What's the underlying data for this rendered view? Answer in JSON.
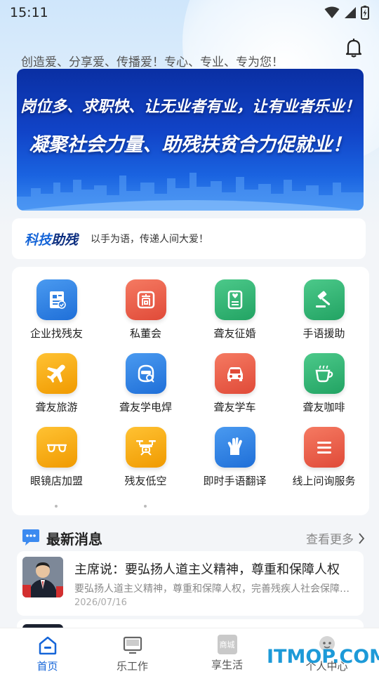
{
  "status_bar": {
    "time": "15:11"
  },
  "header": {
    "slogan": "创造爱、分享爱、传播爱！专心、专业、专为您！"
  },
  "banner": {
    "line1": "岗位多、求职快、让无业者有业，让有业者乐业！",
    "line2": "凝聚社会力量、助残扶贫合力促就业！"
  },
  "tech": {
    "title_part1": "科技",
    "title_part2": "助残",
    "desc": "以手为语，传递人间大爱！"
  },
  "services": [
    {
      "label": "企业找残友",
      "icon": "id-card-icon",
      "color": "#2f7fe0"
    },
    {
      "label": "私董会",
      "icon": "shang-seal-icon",
      "color": "#ee5a45"
    },
    {
      "label": "聋友征婚",
      "icon": "heart-document-icon",
      "color": "#2fb572"
    },
    {
      "label": "手语援助",
      "icon": "gavel-icon",
      "color": "#2fb572"
    },
    {
      "label": "聋友旅游",
      "icon": "airplane-icon",
      "color": "#f5a800"
    },
    {
      "label": "聋友学电焊",
      "icon": "welding-mask-icon",
      "color": "#2f7fe0"
    },
    {
      "label": "聋友学车",
      "icon": "car-icon",
      "color": "#ee5a45"
    },
    {
      "label": "聋友咖啡",
      "icon": "coffee-cup-icon",
      "color": "#2fb572"
    },
    {
      "label": "眼镜店加盟",
      "icon": "glasses-icon",
      "color": "#f5a800"
    },
    {
      "label": "残友低空",
      "icon": "drone-icon",
      "color": "#f5a800"
    },
    {
      "label": "即时手语翻译",
      "icon": "sign-language-icon",
      "color": "#2f7fe0"
    },
    {
      "label": "线上问询服务",
      "icon": "menu-lines-icon",
      "color": "#ee5a45"
    }
  ],
  "news": {
    "section_title": "最新消息",
    "more_label": "查看更多",
    "items": [
      {
        "headline": "主席说：要弘扬人道主义精神，尊重和保障人权",
        "summary": "要弘扬人道主义精神，尊重和保障人权，完善残疾人社会保障制度和关爱服务体系",
        "date": "2026/07/16"
      }
    ]
  },
  "tabs": [
    {
      "label": "首页",
      "icon": "home-icon",
      "active": true
    },
    {
      "label": "乐工作",
      "icon": "monitor-icon",
      "active": false
    },
    {
      "label": "享生活",
      "icon": "mall-icon",
      "active": false
    },
    {
      "label": "个人中心",
      "icon": "user-icon",
      "active": false
    }
  ],
  "watermark": {
    "text": "ITMOP.COM",
    "badge": "商城"
  },
  "colors": {
    "accent": "#1565d8",
    "watermark": "#1d9ad8"
  }
}
